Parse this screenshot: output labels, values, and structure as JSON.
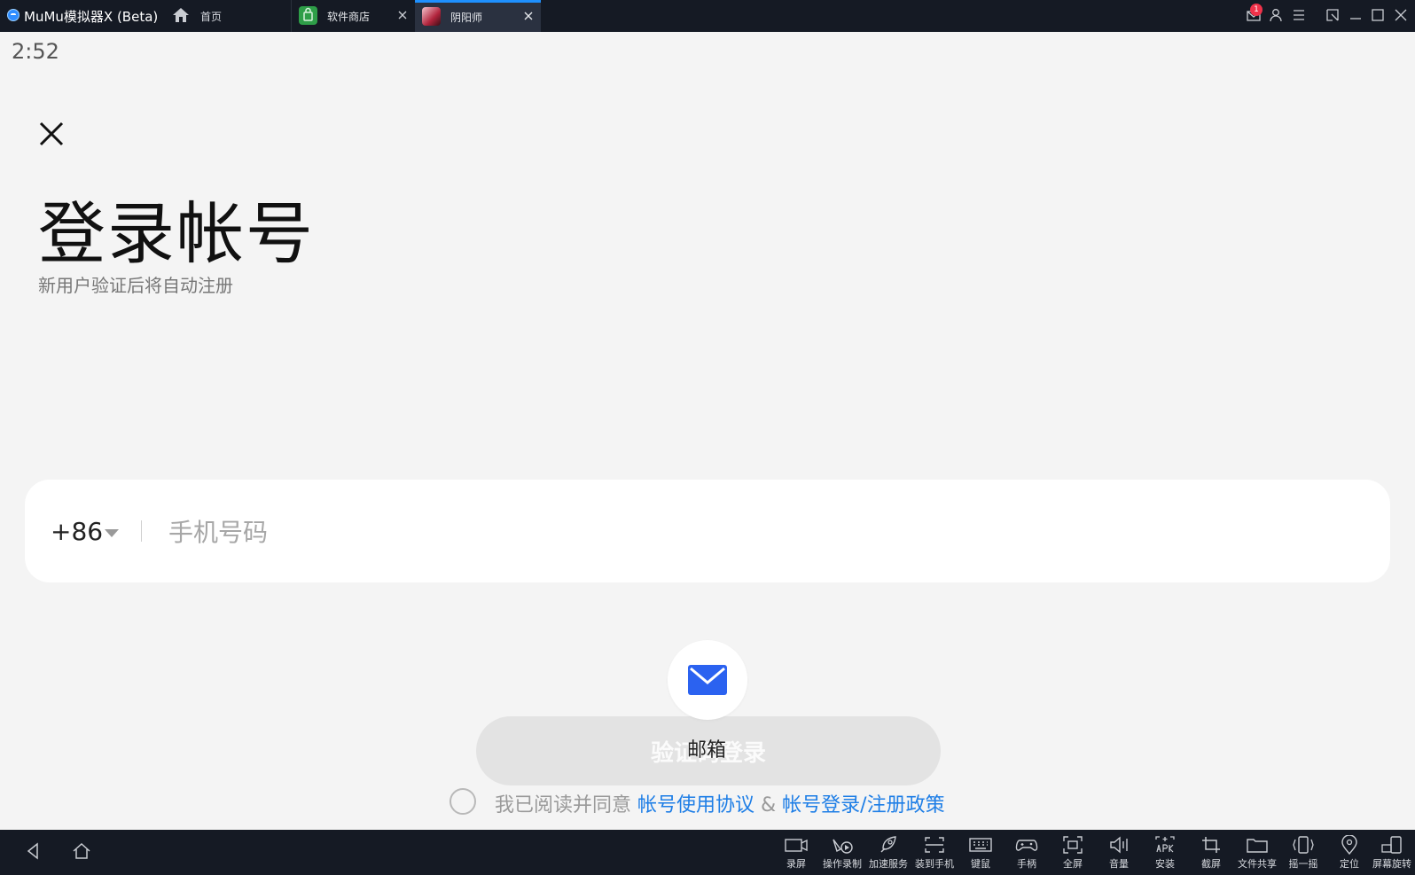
{
  "titlebar": {
    "app_title": "MuMu模拟器X  (Beta)",
    "home_label": "首页",
    "tabs": [
      {
        "label": "软件商店",
        "icon": "app-store-icon"
      },
      {
        "label": "阴阳师",
        "icon": "game-icon",
        "active": true
      }
    ],
    "notification_count": "1",
    "accent_color": "#1e90ff"
  },
  "status": {
    "time": "2:52"
  },
  "login": {
    "title": "登录帐号",
    "subtitle": "新用户验证后将自动注册",
    "country_code": "+86",
    "phone_placeholder": "手机号码",
    "login_button": "验证码登录",
    "email_label": "邮箱",
    "agree_prefix": "我已阅读并同意 ",
    "agree_link1": "帐号使用协议",
    "agree_amp": " & ",
    "agree_link2": "帐号登录/注册政策",
    "link_color": "#1e7ee6"
  },
  "toolbar": {
    "items": [
      {
        "label": "录屏",
        "icon": "record-screen-icon"
      },
      {
        "label": "操作录制",
        "icon": "macro-record-icon"
      },
      {
        "label": "加速服务",
        "icon": "rocket-icon"
      },
      {
        "label": "装到手机",
        "icon": "install-to-phone-icon"
      },
      {
        "label": "键鼠",
        "icon": "keyboard-icon"
      },
      {
        "label": "手柄",
        "icon": "gamepad-icon"
      },
      {
        "label": "全屏",
        "icon": "fullscreen-icon"
      },
      {
        "label": "音量",
        "icon": "volume-icon"
      },
      {
        "label": "安装",
        "icon": "apk-install-icon"
      },
      {
        "label": "截屏",
        "icon": "crop-icon"
      },
      {
        "label": "文件共享",
        "icon": "folder-icon"
      },
      {
        "label": "摇一摇",
        "icon": "shake-icon"
      },
      {
        "label": "定位",
        "icon": "location-icon"
      },
      {
        "label": "屏幕旋转",
        "icon": "rotate-screen-icon"
      }
    ]
  }
}
